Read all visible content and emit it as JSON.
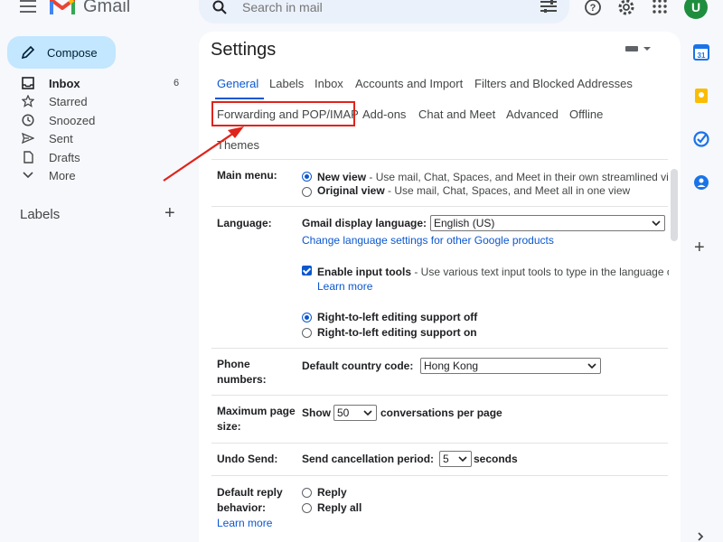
{
  "app": {
    "logo_text": "Gmail",
    "avatar_initial": "U"
  },
  "search": {
    "placeholder": "Search in mail"
  },
  "compose": {
    "label": "Compose"
  },
  "nav": {
    "items": [
      {
        "label": "Inbox",
        "count": "6",
        "icon": "inbox-icon"
      },
      {
        "label": "Starred",
        "icon": "star-icon"
      },
      {
        "label": "Snoozed",
        "icon": "clock-icon"
      },
      {
        "label": "Sent",
        "icon": "send-icon"
      },
      {
        "label": "Drafts",
        "icon": "draft-icon"
      },
      {
        "label": "More",
        "icon": "chevron-down-icon"
      }
    ],
    "labels_heading": "Labels"
  },
  "settings": {
    "title": "Settings",
    "tabs": [
      "General",
      "Labels",
      "Inbox",
      "Accounts and Import",
      "Filters and Blocked Addresses",
      "Forwarding and POP/IMAP",
      "Add-ons",
      "Chat and Meet",
      "Advanced",
      "Offline",
      "Themes"
    ],
    "active_tab": "General",
    "highlighted_tab": "Forwarding and POP/IMAP",
    "main_menu": {
      "label": "Main menu:",
      "options": [
        {
          "title": "New view",
          "desc": " - Use mail, Chat, Spaces, and Meet in their own streamlined views",
          "selected": true
        },
        {
          "title": "Original view",
          "desc": " - Use mail, Chat, Spaces, and Meet all in one view",
          "selected": false
        }
      ]
    },
    "language": {
      "label": "Language:",
      "display_label": "Gmail display language:",
      "display_value": "English (US)",
      "change_link": "Change language settings for other Google products",
      "input_tools_title": "Enable input tools",
      "input_tools_desc": " - Use various text input tools to type in the language of your choice",
      "input_tools_checked": true,
      "learn_more": "Learn more",
      "rtl_off": "Right-to-left editing support off",
      "rtl_on": "Right-to-left editing support on",
      "rtl_selected": "off"
    },
    "phone": {
      "label_line1": "Phone",
      "label_line2": "numbers:",
      "country_label": "Default country code:",
      "country_value": "Hong Kong"
    },
    "page_size": {
      "label_line1": "Maximum page",
      "label_line2": "size:",
      "show": "Show",
      "value": "50",
      "suffix": "conversations per page"
    },
    "undo_send": {
      "label": "Undo Send:",
      "prefix": "Send cancellation period:",
      "value": "5",
      "suffix": "seconds"
    },
    "reply": {
      "label_line1": "Default reply",
      "label_line2": "behavior:",
      "learn_more": "Learn more",
      "options": [
        "Reply",
        "Reply all"
      ]
    }
  },
  "colors": {
    "accent": "#0b57d0",
    "highlight": "#e0241b",
    "compose_bg": "#c2e7ff",
    "avatar_bg": "#1e8e3e"
  }
}
